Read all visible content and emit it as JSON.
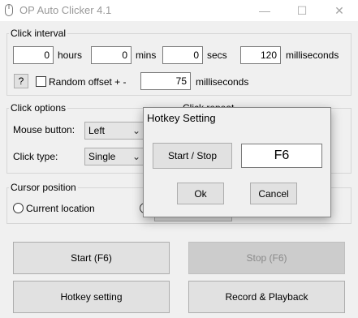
{
  "window": {
    "title": "OP Auto Clicker 4.1",
    "minimize": "—",
    "maximize": "☐",
    "close": "✕"
  },
  "click_interval": {
    "legend": "Click interval",
    "hours_value": "0",
    "hours_label": "hours",
    "mins_value": "0",
    "mins_label": "mins",
    "secs_value": "0",
    "secs_label": "secs",
    "ms_value": "120",
    "ms_label": "milliseconds",
    "help_label": "?",
    "random_offset_label": "Random offset + -",
    "random_offset_checked": false,
    "random_offset_value": "75",
    "random_offset_unit": "milliseconds"
  },
  "click_options": {
    "legend": "Click options",
    "mouse_button_label": "Mouse button:",
    "mouse_button_value": "Left",
    "click_type_label": "Click type:",
    "click_type_value": "Single"
  },
  "click_repeat": {
    "legend": "Click repeat"
  },
  "cursor_position": {
    "legend": "Cursor position",
    "current_location_label": "Current location"
  },
  "buttons": {
    "start": "Start (F6)",
    "stop": "Stop (F6)",
    "hotkey": "Hotkey setting",
    "record": "Record & Playback"
  },
  "dialog": {
    "title": "Hotkey Setting",
    "start_stop": "Start / Stop",
    "hotkey_value": "F6",
    "ok": "Ok",
    "cancel": "Cancel"
  },
  "colors": {
    "window_bg": "#f0f0f0",
    "button_bg": "#e1e1e1",
    "disabled_button_bg": "#cccccc"
  }
}
